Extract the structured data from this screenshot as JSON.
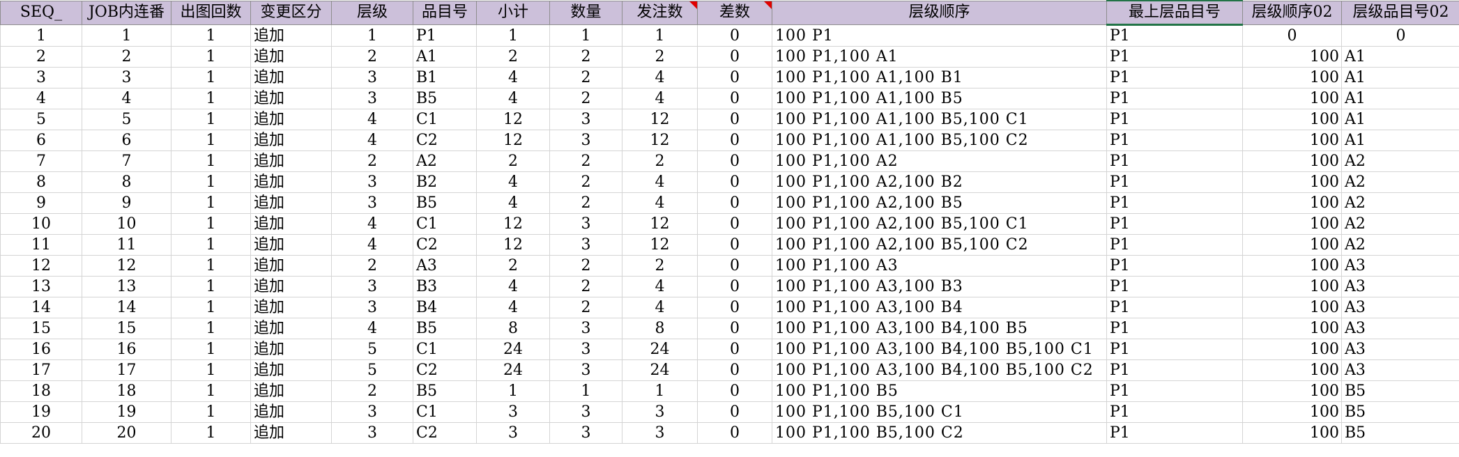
{
  "headers": [
    {
      "label": "SEQ_",
      "align": "ctr"
    },
    {
      "label": "JOB内连番",
      "align": "ctr"
    },
    {
      "label": "出图回数",
      "align": "ctr"
    },
    {
      "label": "变更区分",
      "align": "lft"
    },
    {
      "label": "层级",
      "align": "ctr"
    },
    {
      "label": "品目号",
      "align": "lft"
    },
    {
      "label": "小计",
      "align": "ctr"
    },
    {
      "label": "数量",
      "align": "ctr"
    },
    {
      "label": "发注数",
      "align": "ctr",
      "comment": true
    },
    {
      "label": "差数",
      "align": "ctr",
      "comment": true
    },
    {
      "label": "层级顺序",
      "align": "lft"
    },
    {
      "label": "最上层品目号",
      "align": "lft",
      "active": true
    },
    {
      "label": "层级顺序02",
      "align": "rgt"
    },
    {
      "label": "层级品目号02",
      "align": "lft"
    }
  ],
  "rows": [
    [
      "1",
      "1",
      "1",
      "追加",
      "1",
      "P1",
      "1",
      "1",
      "1",
      "0",
      "100 P1",
      "P1",
      "0",
      "0"
    ],
    [
      "2",
      "2",
      "1",
      "追加",
      "2",
      "A1",
      "2",
      "2",
      "2",
      "0",
      "100 P1,100 A1",
      "P1",
      "100",
      "A1"
    ],
    [
      "3",
      "3",
      "1",
      "追加",
      "3",
      "B1",
      "4",
      "2",
      "4",
      "0",
      "100 P1,100 A1,100 B1",
      "P1",
      "100",
      "A1"
    ],
    [
      "4",
      "4",
      "1",
      "追加",
      "3",
      "B5",
      "4",
      "2",
      "4",
      "0",
      "100 P1,100 A1,100 B5",
      "P1",
      "100",
      "A1"
    ],
    [
      "5",
      "5",
      "1",
      "追加",
      "4",
      "C1",
      "12",
      "3",
      "12",
      "0",
      "100 P1,100 A1,100 B5,100 C1",
      "P1",
      "100",
      "A1"
    ],
    [
      "6",
      "6",
      "1",
      "追加",
      "4",
      "C2",
      "12",
      "3",
      "12",
      "0",
      "100 P1,100 A1,100 B5,100 C2",
      "P1",
      "100",
      "A1"
    ],
    [
      "7",
      "7",
      "1",
      "追加",
      "2",
      "A2",
      "2",
      "2",
      "2",
      "0",
      "100 P1,100 A2",
      "P1",
      "100",
      "A2"
    ],
    [
      "8",
      "8",
      "1",
      "追加",
      "3",
      "B2",
      "4",
      "2",
      "4",
      "0",
      "100 P1,100 A2,100 B2",
      "P1",
      "100",
      "A2"
    ],
    [
      "9",
      "9",
      "1",
      "追加",
      "3",
      "B5",
      "4",
      "2",
      "4",
      "0",
      "100 P1,100 A2,100 B5",
      "P1",
      "100",
      "A2"
    ],
    [
      "10",
      "10",
      "1",
      "追加",
      "4",
      "C1",
      "12",
      "3",
      "12",
      "0",
      "100 P1,100 A2,100 B5,100 C1",
      "P1",
      "100",
      "A2"
    ],
    [
      "11",
      "11",
      "1",
      "追加",
      "4",
      "C2",
      "12",
      "3",
      "12",
      "0",
      "100 P1,100 A2,100 B5,100 C2",
      "P1",
      "100",
      "A2"
    ],
    [
      "12",
      "12",
      "1",
      "追加",
      "2",
      "A3",
      "2",
      "2",
      "2",
      "0",
      "100 P1,100 A3",
      "P1",
      "100",
      "A3"
    ],
    [
      "13",
      "13",
      "1",
      "追加",
      "3",
      "B3",
      "4",
      "2",
      "4",
      "0",
      "100 P1,100 A3,100 B3",
      "P1",
      "100",
      "A3"
    ],
    [
      "14",
      "14",
      "1",
      "追加",
      "3",
      "B4",
      "4",
      "2",
      "4",
      "0",
      "100 P1,100 A3,100 B4",
      "P1",
      "100",
      "A3"
    ],
    [
      "15",
      "15",
      "1",
      "追加",
      "4",
      "B5",
      "8",
      "3",
      "8",
      "0",
      "100 P1,100 A3,100 B4,100 B5",
      "P1",
      "100",
      "A3"
    ],
    [
      "16",
      "16",
      "1",
      "追加",
      "5",
      "C1",
      "24",
      "3",
      "24",
      "0",
      "100 P1,100 A3,100 B4,100 B5,100 C1",
      "P1",
      "100",
      "A3"
    ],
    [
      "17",
      "17",
      "1",
      "追加",
      "5",
      "C2",
      "24",
      "3",
      "24",
      "0",
      "100 P1,100 A3,100 B4,100 B5,100 C2",
      "P1",
      "100",
      "A3"
    ],
    [
      "18",
      "18",
      "1",
      "追加",
      "2",
      "B5",
      "1",
      "1",
      "1",
      "0",
      "100 P1,100 B5",
      "P1",
      "100",
      "B5"
    ],
    [
      "19",
      "19",
      "1",
      "追加",
      "3",
      "C1",
      "3",
      "3",
      "3",
      "0",
      "100 P1,100 B5,100 C1",
      "P1",
      "100",
      "B5"
    ],
    [
      "20",
      "20",
      "1",
      "追加",
      "3",
      "C2",
      "3",
      "3",
      "3",
      "0",
      "100 P1,100 B5,100 C2",
      "P1",
      "100",
      "B5"
    ]
  ],
  "cell_align": [
    "ctr",
    "ctr",
    "ctr",
    "lft",
    "ctr",
    "lft",
    "ctr",
    "ctr",
    "ctr",
    "ctr",
    "lft",
    "lft",
    "rgt",
    "lft"
  ],
  "row0_overrides": {
    "12": "ctr",
    "13": "ctr"
  },
  "colors": {
    "header_bg": "#ccc0da",
    "grid_line": "#d4d4d4",
    "comment_indicator": "#e00000",
    "active_cell_border": "#217346"
  }
}
